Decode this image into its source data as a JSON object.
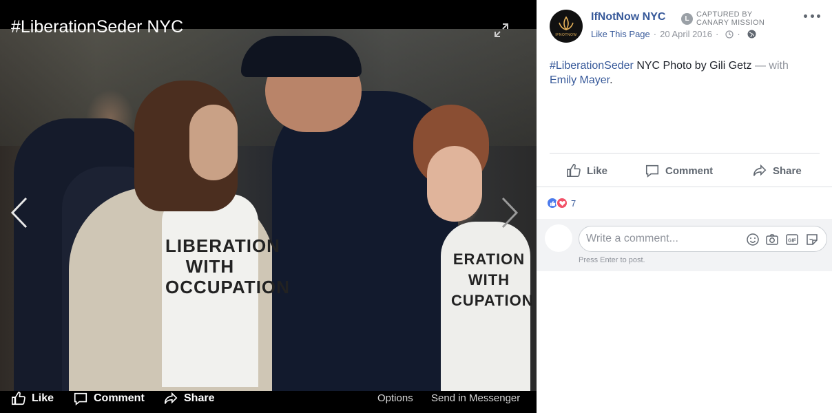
{
  "viewer": {
    "title": "#LiberationSeder NYC",
    "shirt_text_main": "LIBERATION WITH OCCUPATION",
    "shirt_text_side": "ERATION WITH CUPATION",
    "actions": {
      "like": "Like",
      "comment": "Comment",
      "share": "Share",
      "options": "Options",
      "send_messenger": "Send in Messenger"
    }
  },
  "post": {
    "page_name": "IfNotNow NYC",
    "avatar_logo_text": "IFNOTNOW",
    "badge": {
      "line1": "Captured by",
      "line2": "Canary Mission"
    },
    "like_page": "Like This Page",
    "date": "20 April 2016",
    "caption": {
      "hashtag": "#LiberationSeder",
      "text": " NYC Photo by Gili Getz",
      "with": " — with",
      "tagged": "Emily Mayer",
      "end": "."
    },
    "actions": {
      "like": "Like",
      "comment": "Comment",
      "share": "Share"
    },
    "reaction_count": "7",
    "comment_placeholder": "Write a comment...",
    "press_enter": "Press Enter to post."
  },
  "colors": {
    "link": "#365899",
    "muted": "#90949c",
    "like_blue": "#4b7bec",
    "love_red": "#f25268"
  }
}
